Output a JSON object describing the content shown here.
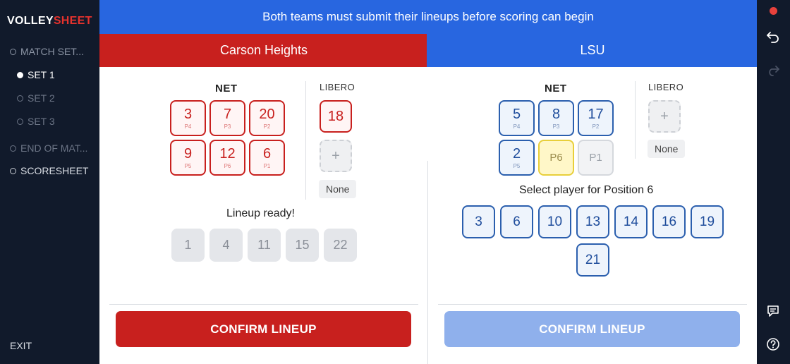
{
  "app": {
    "logo_part1": "VOLLEY",
    "logo_part2": "SHEET"
  },
  "sidebar": {
    "items": [
      {
        "label": "MATCH SET..."
      },
      {
        "label": "SET 1"
      },
      {
        "label": "SET 2"
      },
      {
        "label": "SET 3"
      },
      {
        "label": "END OF MAT..."
      },
      {
        "label": "SCORESHEET"
      }
    ],
    "exit_label": "EXIT"
  },
  "banner": {
    "text": "Both teams must submit their lineups before scoring can begin"
  },
  "home": {
    "name": "Carson Heights",
    "net_label": "NET",
    "libero_label": "LIBERO",
    "court": [
      {
        "num": "3",
        "pos": "P4"
      },
      {
        "num": "7",
        "pos": "P3"
      },
      {
        "num": "20",
        "pos": "P2"
      },
      {
        "num": "9",
        "pos": "P5"
      },
      {
        "num": "12",
        "pos": "P6"
      },
      {
        "num": "6",
        "pos": "P1"
      }
    ],
    "libero": "18",
    "libero_add": "+",
    "libero_none": "None",
    "status": "Lineup ready!",
    "bench": [
      "1",
      "4",
      "11",
      "15",
      "22"
    ],
    "confirm_label": "CONFIRM LINEUP"
  },
  "away": {
    "name": "LSU",
    "net_label": "NET",
    "libero_label": "LIBERO",
    "court": [
      {
        "num": "5",
        "pos": "P4"
      },
      {
        "num": "8",
        "pos": "P3"
      },
      {
        "num": "17",
        "pos": "P2"
      },
      {
        "num": "2",
        "pos": "P5"
      },
      {
        "num": "P6",
        "pos": ""
      },
      {
        "num": "P1",
        "pos": ""
      }
    ],
    "libero_add": "+",
    "libero_none": "None",
    "prompt": "Select player for Position 6",
    "roster": [
      "3",
      "6",
      "10",
      "13",
      "14",
      "16",
      "19",
      "21"
    ],
    "confirm_label": "CONFIRM LINEUP"
  },
  "colors": {
    "home": "#c8201e",
    "away": "#2866e0",
    "sidebar": "#111a2b",
    "selected": "#fff7c8"
  },
  "rail_icons": [
    "record-dot",
    "undo-icon",
    "redo-icon",
    "chat-icon",
    "help-icon"
  ]
}
